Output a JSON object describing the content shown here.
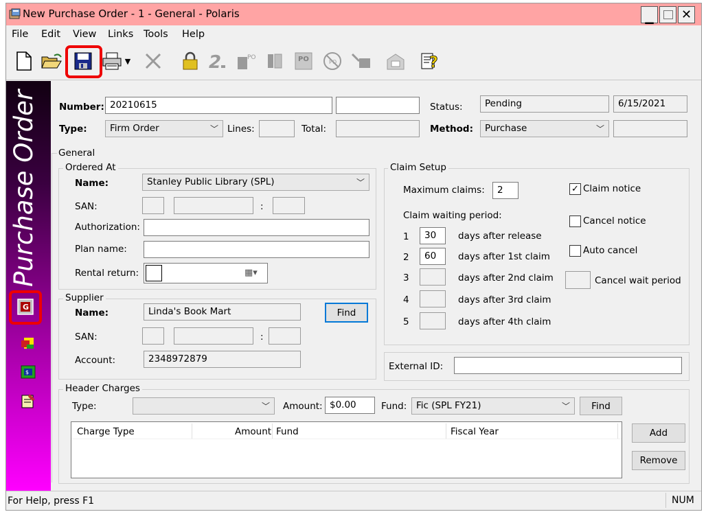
{
  "window": {
    "title": "New Purchase Order - 1 - General - Polaris"
  },
  "menu": {
    "file": "File",
    "edit": "Edit",
    "view": "View",
    "links": "Links",
    "tools": "Tools",
    "help": "Help"
  },
  "sidebar": {
    "vertical_title": "Purchase Order"
  },
  "header": {
    "number_label": "Number:",
    "number_value": "20210615",
    "number_extra": "",
    "status_label": "Status:",
    "status_value": "Pending",
    "status_date": "6/15/2021",
    "type_label": "Type:",
    "type_value": "Firm Order",
    "lines_label": "Lines:",
    "lines_value": "",
    "total_label": "Total:",
    "total_value": "",
    "method_label": "Method:",
    "method_value": "Purchase",
    "method_extra": ""
  },
  "general": {
    "title": "General",
    "ordered_at": {
      "title": "Ordered At",
      "name_label": "Name:",
      "name_value": "Stanley Public Library (SPL)",
      "san_label": "SAN:",
      "san_sep": ":",
      "authorization_label": "Authorization:",
      "authorization_value": "",
      "plan_name_label": "Plan name:",
      "plan_name_value": "",
      "rental_return_label": "Rental return:"
    },
    "supplier": {
      "title": "Supplier",
      "name_label": "Name:",
      "name_value": "Linda's Book Mart",
      "find_label": "Find",
      "san_label": "SAN:",
      "san_sep": ":",
      "account_label": "Account:",
      "account_value": "2348972879"
    },
    "claim_setup": {
      "title": "Claim Setup",
      "max_claims_label": "Maximum claims:",
      "max_claims_value": "2",
      "claim_notice_label": "Claim notice",
      "claim_notice_checked": true,
      "waiting_period_label": "Claim waiting period:",
      "cancel_notice_label": "Cancel notice",
      "cancel_notice_checked": false,
      "auto_cancel_label": "Auto cancel",
      "auto_cancel_checked": false,
      "cancel_wait_period_label": "Cancel wait period",
      "rows": [
        {
          "num": "1",
          "value": "30",
          "label": "days after release"
        },
        {
          "num": "2",
          "value": "60",
          "label": "days after 1st claim"
        },
        {
          "num": "3",
          "value": "",
          "label": "days after 2nd claim"
        },
        {
          "num": "4",
          "value": "",
          "label": "days after 3rd claim"
        },
        {
          "num": "5",
          "value": "",
          "label": "days after 4th claim"
        }
      ]
    },
    "external_id_label": "External ID:",
    "external_id_value": ""
  },
  "header_charges": {
    "title": "Header Charges",
    "type_label": "Type:",
    "type_value": "",
    "amount_label": "Amount:",
    "amount_value": "$0.00",
    "fund_label": "Fund:",
    "fund_value": "Fic (SPL FY21)",
    "find_label": "Find",
    "columns": {
      "charge_type": "Charge Type",
      "amount": "Amount",
      "fund": "Fund",
      "fiscal_year": "Fiscal Year"
    },
    "add_label": "Add",
    "remove_label": "Remove"
  },
  "statusbar": {
    "help_text": "For Help, press F1",
    "num": "NUM"
  },
  "colors": {
    "titlebar": "#ffa4a4",
    "sidebar_top": "#110011",
    "sidebar_bottom": "#ff00ff",
    "highlight": "#ee0000"
  }
}
